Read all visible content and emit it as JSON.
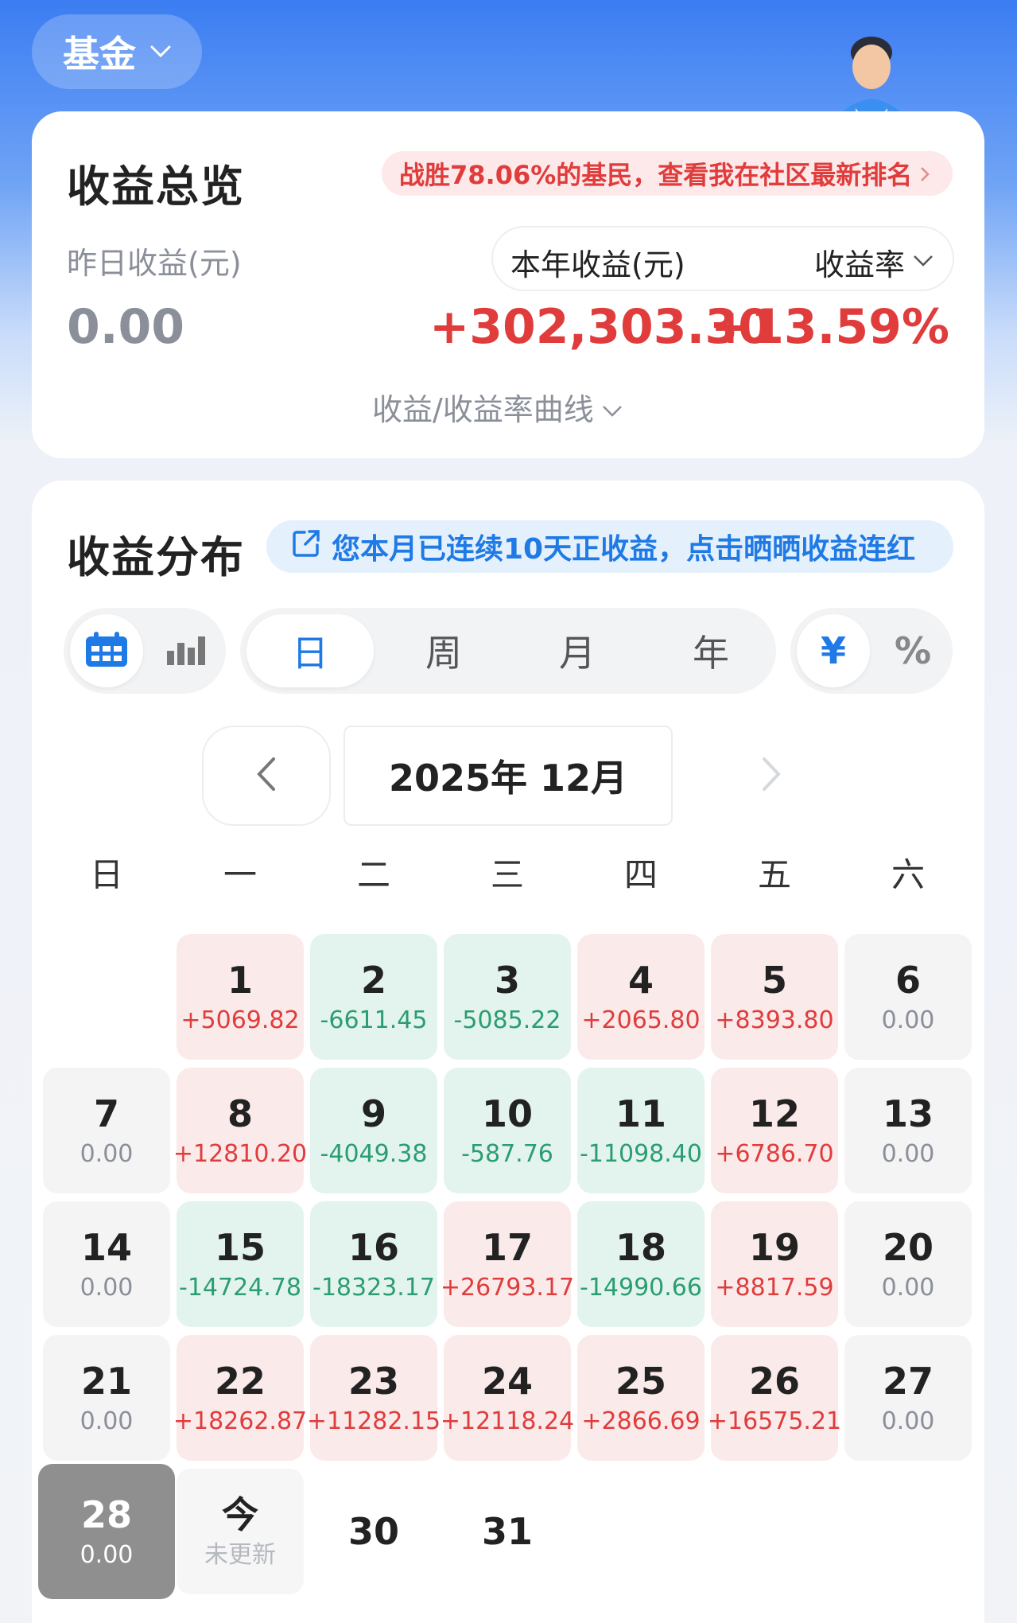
{
  "top": {
    "asset_label": "基金"
  },
  "overview": {
    "title": "收益总览",
    "rank_text": "战胜78.06%的基民，查看我在社区最新排名",
    "yesterday_label": "昨日收益(元)",
    "yesterday_value": "0.00",
    "year_label": "本年收益(元)",
    "rate_label": "收益率",
    "year_value": "+302,303.30",
    "rate_value": "+13.59%",
    "curve_link": "收益/收益率曲线"
  },
  "distribution": {
    "title": "收益分布",
    "streak_text": "您本月已连续10天正收益，点击晒晒收益连红",
    "periods": [
      "日",
      "周",
      "月",
      "年"
    ],
    "active_period": "日",
    "units": [
      "¥",
      "%"
    ],
    "active_unit": "¥",
    "month_label": "2025年 12月",
    "weekdays": [
      "日",
      "一",
      "二",
      "三",
      "四",
      "五",
      "六"
    ],
    "days": [
      {
        "day": "1",
        "value": "+5069.82",
        "status": "pos"
      },
      {
        "day": "2",
        "value": "-6611.45",
        "status": "neg"
      },
      {
        "day": "3",
        "value": "-5085.22",
        "status": "neg"
      },
      {
        "day": "4",
        "value": "+2065.80",
        "status": "pos"
      },
      {
        "day": "5",
        "value": "+8393.80",
        "status": "pos"
      },
      {
        "day": "6",
        "value": "0.00",
        "status": "zero"
      },
      {
        "day": "7",
        "value": "0.00",
        "status": "zero"
      },
      {
        "day": "8",
        "value": "+12810.20",
        "status": "pos"
      },
      {
        "day": "9",
        "value": "-4049.38",
        "status": "neg"
      },
      {
        "day": "10",
        "value": "-587.76",
        "status": "neg"
      },
      {
        "day": "11",
        "value": "-11098.40",
        "status": "neg"
      },
      {
        "day": "12",
        "value": "+6786.70",
        "status": "pos"
      },
      {
        "day": "13",
        "value": "0.00",
        "status": "zero"
      },
      {
        "day": "14",
        "value": "0.00",
        "status": "zero"
      },
      {
        "day": "15",
        "value": "-14724.78",
        "status": "neg"
      },
      {
        "day": "16",
        "value": "-18323.17",
        "status": "neg"
      },
      {
        "day": "17",
        "value": "+26793.17",
        "status": "pos"
      },
      {
        "day": "18",
        "value": "-14990.66",
        "status": "neg"
      },
      {
        "day": "19",
        "value": "+8817.59",
        "status": "pos"
      },
      {
        "day": "20",
        "value": "0.00",
        "status": "zero"
      },
      {
        "day": "21",
        "value": "0.00",
        "status": "zero"
      },
      {
        "day": "22",
        "value": "+18262.87",
        "status": "pos"
      },
      {
        "day": "23",
        "value": "+11282.15",
        "status": "pos"
      },
      {
        "day": "24",
        "value": "+12118.24",
        "status": "pos"
      },
      {
        "day": "25",
        "value": "+2866.69",
        "status": "pos"
      },
      {
        "day": "26",
        "value": "+16575.21",
        "status": "pos"
      },
      {
        "day": "27",
        "value": "0.00",
        "status": "zero"
      },
      {
        "day": "28",
        "value": "0.00",
        "status": "sel"
      },
      {
        "day": "今",
        "value": "未更新",
        "status": "today"
      },
      {
        "day": "30",
        "value": "",
        "status": "future"
      },
      {
        "day": "31",
        "value": "",
        "status": "future"
      }
    ]
  },
  "colors": {
    "accent": "#1f7ae6",
    "gain": "#e03c3c",
    "loss": "#2b9d72"
  }
}
